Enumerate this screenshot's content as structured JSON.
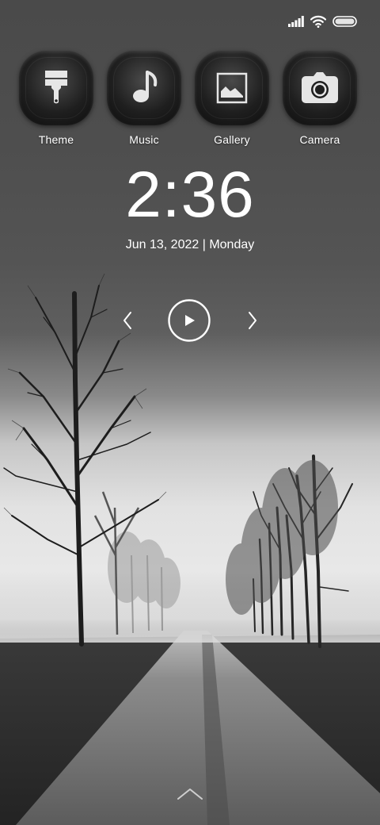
{
  "status_bar": {
    "icons": [
      "signal-icon",
      "wifi-icon",
      "battery-icon"
    ]
  },
  "apps": [
    {
      "label": "Theme",
      "icon": "paintbrush-icon"
    },
    {
      "label": "Music",
      "icon": "music-note-icon"
    },
    {
      "label": "Gallery",
      "icon": "image-icon"
    },
    {
      "label": "Camera",
      "icon": "camera-icon"
    }
  ],
  "clock": {
    "time": "2:36",
    "date": "Jun 13, 2022 | Monday"
  },
  "music_controls": {
    "icons": [
      "chevron-left-icon",
      "play-icon",
      "chevron-right-icon"
    ]
  },
  "unlock": {
    "icon": "chevron-up-icon"
  },
  "colors": {
    "text": "#ffffff",
    "icon_background": "#1f1f1f"
  }
}
